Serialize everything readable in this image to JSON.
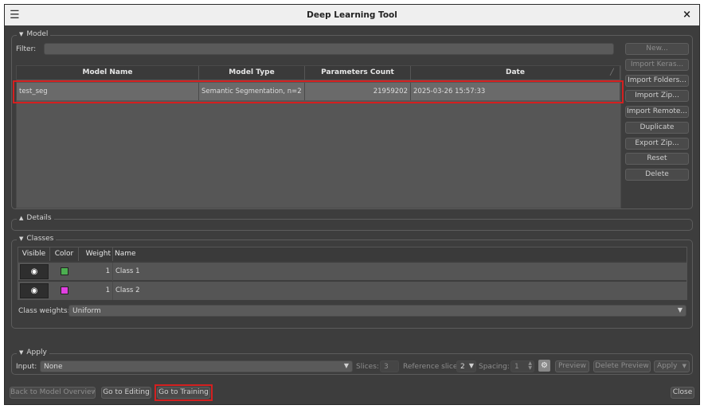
{
  "window": {
    "title": "Deep Learning Tool",
    "menu_icon": "hamburger-icon",
    "close_icon": "close-icon",
    "close_glyph": "×"
  },
  "model": {
    "group_label": "Model",
    "filter_label": "Filter:",
    "filter_value": "",
    "columns": [
      "Model Name",
      "Model Type",
      "Parameters Count",
      "Date"
    ],
    "rows": [
      {
        "name": "test_seg",
        "type": "Semantic Segmentation, n=2",
        "params": "21959202",
        "date": "2025-03-26 15:57:33"
      }
    ],
    "buttons": {
      "new": "New...",
      "import_keras": "Import Keras...",
      "import_folders": "Import Folders...",
      "import_zip": "Import Zip...",
      "import_remote": "Import Remote...",
      "duplicate": "Duplicate",
      "export_zip": "Export Zip...",
      "reset": "Reset",
      "delete": "Delete"
    }
  },
  "details": {
    "group_label": "Details"
  },
  "classes": {
    "group_label": "Classes",
    "columns": [
      "Visible",
      "Color",
      "Weight",
      "Name"
    ],
    "rows": [
      {
        "visible_icon": "eye-icon",
        "color": "#4caf50",
        "weight": "1",
        "name": "Class 1"
      },
      {
        "visible_icon": "eye-icon",
        "color": "#e040e0",
        "weight": "1",
        "name": "Class 2"
      }
    ],
    "weights_label": "Class weights:",
    "weights_value": "Uniform"
  },
  "apply": {
    "group_label": "Apply",
    "input_label": "Input:",
    "input_value": "None",
    "slices_label": "Slices:",
    "slices_value": "3",
    "ref_slice_label": "Reference slice:",
    "ref_slice_value": "2",
    "spacing_label": "Spacing:",
    "spacing_value": "1",
    "preview": "Preview",
    "delete_preview": "Delete Preview",
    "apply_btn": "Apply"
  },
  "footer": {
    "back": "Back to Model Overview",
    "editing": "Go to Editing",
    "training": "Go to Training",
    "close": "Close"
  },
  "colors": {
    "highlight": "#d42020",
    "bg": "#3d3d3d"
  }
}
